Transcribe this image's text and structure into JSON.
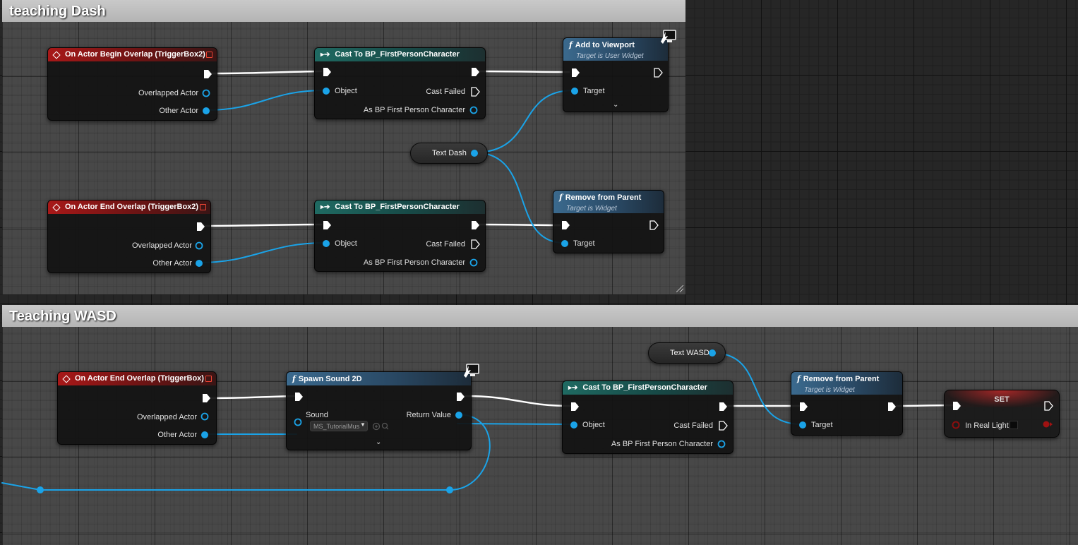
{
  "comments": {
    "dash_title": "teaching Dash",
    "wasd_title": "Teaching WASD"
  },
  "dash": {
    "begin_overlap": {
      "title": "On Actor Begin Overlap (TriggerBox2)",
      "overlapped_actor": "Overlapped Actor",
      "other_actor": "Other Actor"
    },
    "cast1": {
      "title": "Cast To BP_FirstPersonCharacter",
      "object": "Object",
      "cast_failed": "Cast Failed",
      "as_char": "As BP First Person Character"
    },
    "add_viewport": {
      "title": "Add to Viewport",
      "subtitle": "Target is User Widget",
      "target": "Target"
    },
    "text_dash": "Text Dash",
    "end_overlap": {
      "title": "On Actor End Overlap (TriggerBox2)",
      "overlapped_actor": "Overlapped Actor",
      "other_actor": "Other Actor"
    },
    "cast2": {
      "title": "Cast To BP_FirstPersonCharacter",
      "object": "Object",
      "cast_failed": "Cast Failed",
      "as_char": "As BP First Person Character"
    },
    "remove_parent": {
      "title": "Remove from Parent",
      "subtitle": "Target is Widget",
      "target": "Target"
    }
  },
  "wasd": {
    "end_overlap": {
      "title": "On Actor End Overlap (TriggerBox)",
      "overlapped_actor": "Overlapped Actor",
      "other_actor": "Other Actor"
    },
    "spawn_sound": {
      "title": "Spawn Sound 2D",
      "sound": "Sound",
      "sound_value": "MS_TutorialMus",
      "return_value": "Return Value"
    },
    "text_wasd": "Text WASD",
    "cast": {
      "title": "Cast To BP_FirstPersonCharacter",
      "object": "Object",
      "cast_failed": "Cast Failed",
      "as_char": "As BP First Person Character"
    },
    "remove_parent": {
      "title": "Remove from Parent",
      "subtitle": "Target is Widget",
      "target": "Target"
    },
    "set": {
      "title": "SET",
      "in_real_light": "In Real Light"
    }
  },
  "colors": {
    "exec_wire": "#ffffff",
    "object_wire": "#1aa3e8",
    "event_header": "#a81818",
    "cast_header": "#1f6a62",
    "function_header": "#3b6a8e"
  }
}
